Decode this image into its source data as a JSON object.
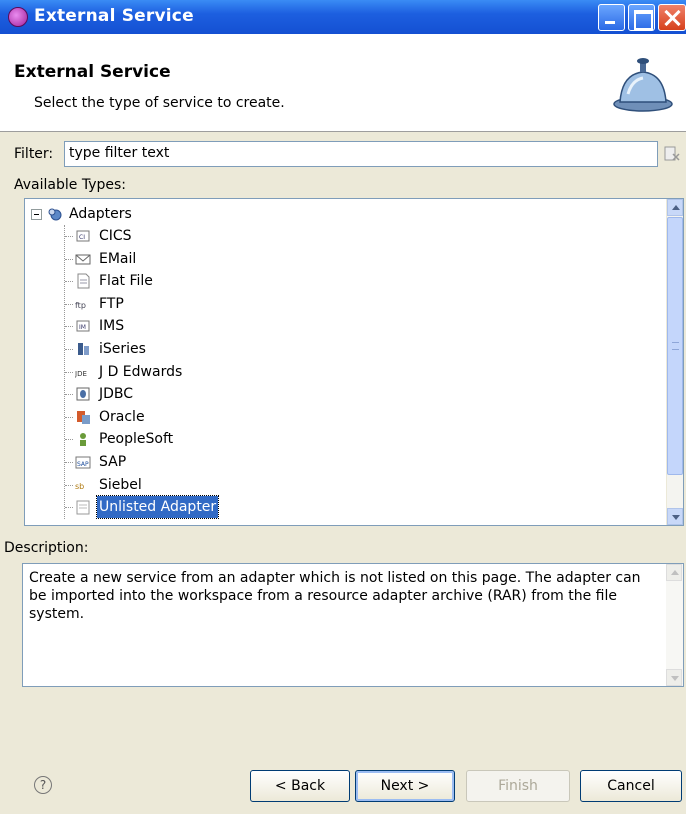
{
  "window": {
    "title": "External Service"
  },
  "banner": {
    "title": "External Service",
    "subtitle": "Select the type of service to create."
  },
  "filter": {
    "label": "Filter:",
    "value": "type filter text"
  },
  "types": {
    "label": "Available Types:",
    "root": {
      "label": "Adapters",
      "icon": "adapters-folder-icon",
      "expanded": true
    },
    "items": [
      {
        "label": "CICS",
        "icon": "cics-icon"
      },
      {
        "label": "EMail",
        "icon": "email-icon"
      },
      {
        "label": "Flat File",
        "icon": "flat-file-icon"
      },
      {
        "label": "FTP",
        "icon": "ftp-icon"
      },
      {
        "label": "IMS",
        "icon": "ims-icon"
      },
      {
        "label": "iSeries",
        "icon": "iseries-icon"
      },
      {
        "label": "J D Edwards",
        "icon": "jde-icon"
      },
      {
        "label": "JDBC",
        "icon": "jdbc-icon"
      },
      {
        "label": "Oracle",
        "icon": "oracle-icon"
      },
      {
        "label": "PeopleSoft",
        "icon": "peoplesoft-icon"
      },
      {
        "label": "SAP",
        "icon": "sap-icon"
      },
      {
        "label": "Siebel",
        "icon": "siebel-icon"
      },
      {
        "label": "Unlisted Adapter",
        "icon": "unlisted-adapter-icon",
        "selected": true
      }
    ]
  },
  "description": {
    "label": "Description:",
    "text": "Create a new service from an adapter which is not listed on this page.  The adapter can be imported into the workspace from a resource adapter archive (RAR) from the file system."
  },
  "buttons": {
    "back": "< Back",
    "next": "Next >",
    "finish": "Finish",
    "cancel": "Cancel"
  },
  "help": {
    "glyph": "?"
  },
  "colors": {
    "titlebar": "#1d5fe0",
    "selection": "#316ac5",
    "dialog_bg": "#ece9d8"
  }
}
